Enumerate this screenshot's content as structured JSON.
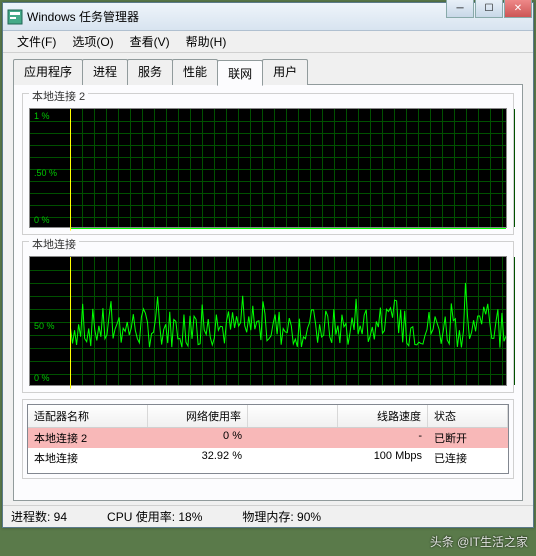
{
  "window": {
    "title": "Windows 任务管理器"
  },
  "menu": {
    "file": "文件(F)",
    "options": "选项(O)",
    "view": "查看(V)",
    "help": "帮助(H)"
  },
  "tabs": {
    "apps": "应用程序",
    "processes": "进程",
    "services": "服务",
    "performance": "性能",
    "networking": "联网",
    "users": "用户"
  },
  "graphs": {
    "g1_label": "本地连接 2",
    "g2_label": "本地连接",
    "y1": "1 %",
    "y50": ".50 %",
    "y0": "0 %",
    "z50": "50 %",
    "z0": "0 %"
  },
  "table": {
    "headers": {
      "name": "适配器名称",
      "usage": "网络使用率",
      "speed": "线路速度",
      "state": "状态"
    },
    "rows": [
      {
        "name": "本地连接 2",
        "usage": "0 %",
        "speed": "-",
        "state": "已断开",
        "selected": true
      },
      {
        "name": "本地连接",
        "usage": "32.92 %",
        "speed": "100 Mbps",
        "state": "已连接",
        "selected": false
      }
    ]
  },
  "status": {
    "processes": "进程数: 94",
    "cpu": "CPU 使用率: 18%",
    "memory": "物理内存: 90%"
  },
  "watermark": "头条 @IT生活之家",
  "chart_data": [
    {
      "type": "line",
      "title": "本地连接 2",
      "ylabel": "网络使用率 %",
      "ylim": [
        0,
        1
      ],
      "values_approx": "flat zero (adapter disconnected)"
    },
    {
      "type": "line",
      "title": "本地连接",
      "ylabel": "网络使用率 %",
      "ylim": [
        0,
        100
      ],
      "values_approx": "noisy fluctuation roughly 15-45%, current 32.92%"
    }
  ]
}
